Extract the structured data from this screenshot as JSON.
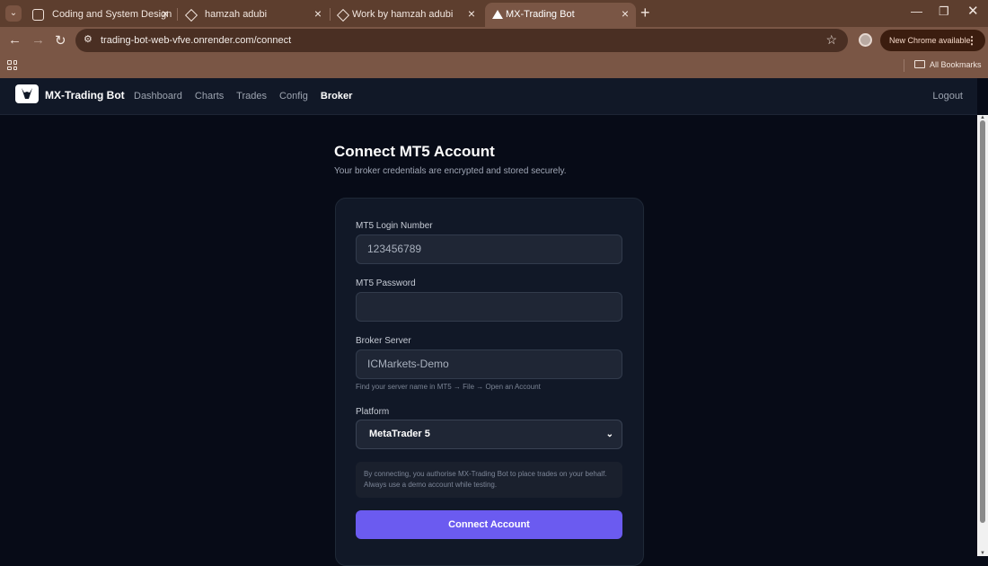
{
  "browser": {
    "tabs": [
      {
        "title": "Coding and System Design",
        "icon": "openai-icon"
      },
      {
        "title": "hamzah adubi",
        "icon": "diamond-icon"
      },
      {
        "title": "Work by hamzah adubi",
        "icon": "diamond-icon"
      },
      {
        "title": "MX-Trading Bot",
        "icon": "render-icon"
      }
    ],
    "url": "trading-bot-web-vfve.onrender.com/connect",
    "update_label": "New Chrome available",
    "all_bookmarks": "All Bookmarks"
  },
  "site": {
    "brand": "MX-Trading Bot",
    "nav": [
      "Dashboard",
      "Charts",
      "Trades",
      "Config",
      "Broker"
    ],
    "active_nav": "Broker",
    "logout": "Logout"
  },
  "page": {
    "title": "Connect MT5 Account",
    "subtitle": "Your broker credentials are encrypted and stored securely."
  },
  "form": {
    "login_label": "MT5 Login Number",
    "login_placeholder": "123456789",
    "password_label": "MT5 Password",
    "password_value": "",
    "server_label": "Broker Server",
    "server_placeholder": "ICMarkets-Demo",
    "server_hint": "Find your server name in MT5 → File → Open an Account",
    "platform_label": "Platform",
    "platform_selected": "MetaTrader 5",
    "notice": "By connecting, you authorise MX-Trading Bot to place trades on your behalf. Always use a demo account while testing.",
    "submit_label": "Connect Account"
  },
  "colors": {
    "accent": "#6b5bf0",
    "background": "#070b17",
    "card": "#111827"
  }
}
